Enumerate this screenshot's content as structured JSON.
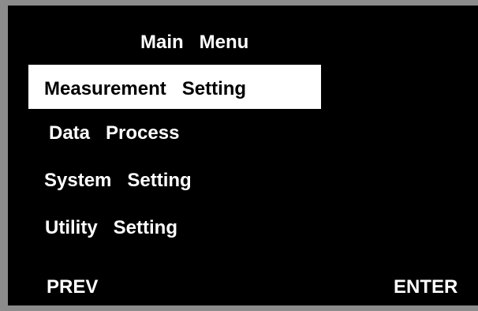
{
  "menu": {
    "title": "Main   Menu",
    "items": [
      {
        "label": "Measurement   Setting",
        "selected": true
      },
      {
        "label": "Data   Process",
        "selected": false
      },
      {
        "label": "System   Setting",
        "selected": false
      },
      {
        "label": "Utility   Setting",
        "selected": false
      }
    ]
  },
  "softkeys": {
    "prev": "PREV",
    "enter": "ENTER"
  },
  "colors": {
    "screen_bg": "#000000",
    "text": "#ffffff",
    "selected_bg": "#ffffff",
    "selected_text": "#000000",
    "bezel": "#8c8c8c"
  }
}
